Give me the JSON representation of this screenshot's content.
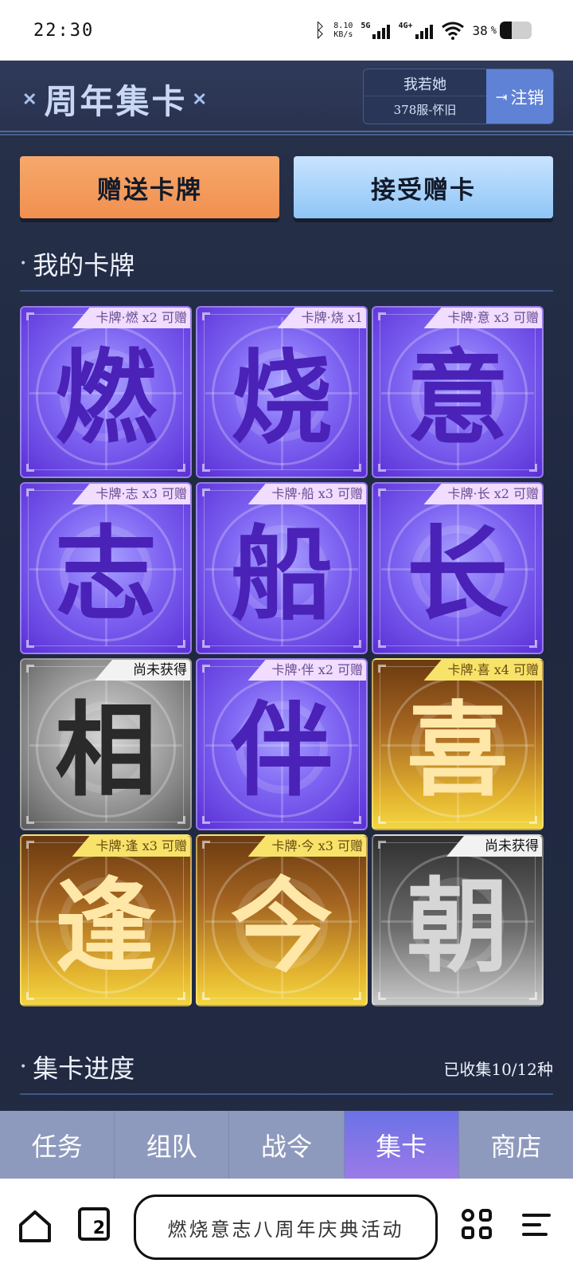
{
  "status_bar": {
    "time": "22:30",
    "net_speed_value": "8.10",
    "net_speed_unit": "KB/s",
    "signal1_label": "5G",
    "signal2_label": "4G+",
    "battery": "38",
    "battery_level": 0.38
  },
  "header": {
    "title": "周年集卡",
    "user_name": "我若她",
    "user_server": "378服-怀旧",
    "logout_label": "注销"
  },
  "actions": {
    "gift_label": "赠送卡牌",
    "accept_label": "接受赠卡"
  },
  "my_cards": {
    "title": "我的卡牌",
    "cards": [
      {
        "char": "燃",
        "tag": "卡牌·燃 x2 可赠",
        "style": "purple"
      },
      {
        "char": "烧",
        "tag": "卡牌·烧 x1",
        "style": "purple"
      },
      {
        "char": "意",
        "tag": "卡牌·意 x3 可赠",
        "style": "purple"
      },
      {
        "char": "志",
        "tag": "卡牌·志 x3 可赠",
        "style": "purple"
      },
      {
        "char": "船",
        "tag": "卡牌·船 x3 可赠",
        "style": "purple"
      },
      {
        "char": "长",
        "tag": "卡牌·长 x2 可赠",
        "style": "purple"
      },
      {
        "char": "相",
        "tag": "尚未获得",
        "style": "gray"
      },
      {
        "char": "伴",
        "tag": "卡牌·伴 x2 可赠",
        "style": "purple"
      },
      {
        "char": "喜",
        "tag": "卡牌·喜 x4 可赠",
        "style": "gold"
      },
      {
        "char": "逢",
        "tag": "卡牌·逢 x3 可赠",
        "style": "gold"
      },
      {
        "char": "今",
        "tag": "卡牌·今 x3 可赠",
        "style": "gold"
      },
      {
        "char": "朝",
        "tag": "尚未获得",
        "style": "dark"
      }
    ]
  },
  "progress": {
    "title": "集卡进度",
    "count": "已收集10/12种"
  },
  "tabs": [
    {
      "label": "任务",
      "active": false
    },
    {
      "label": "组队",
      "active": false
    },
    {
      "label": "战令",
      "active": false
    },
    {
      "label": "集卡",
      "active": true
    },
    {
      "label": "商店",
      "active": false
    }
  ],
  "browser": {
    "tab_count": "2",
    "address_text": "燃烧意志八周年庆典活动"
  }
}
